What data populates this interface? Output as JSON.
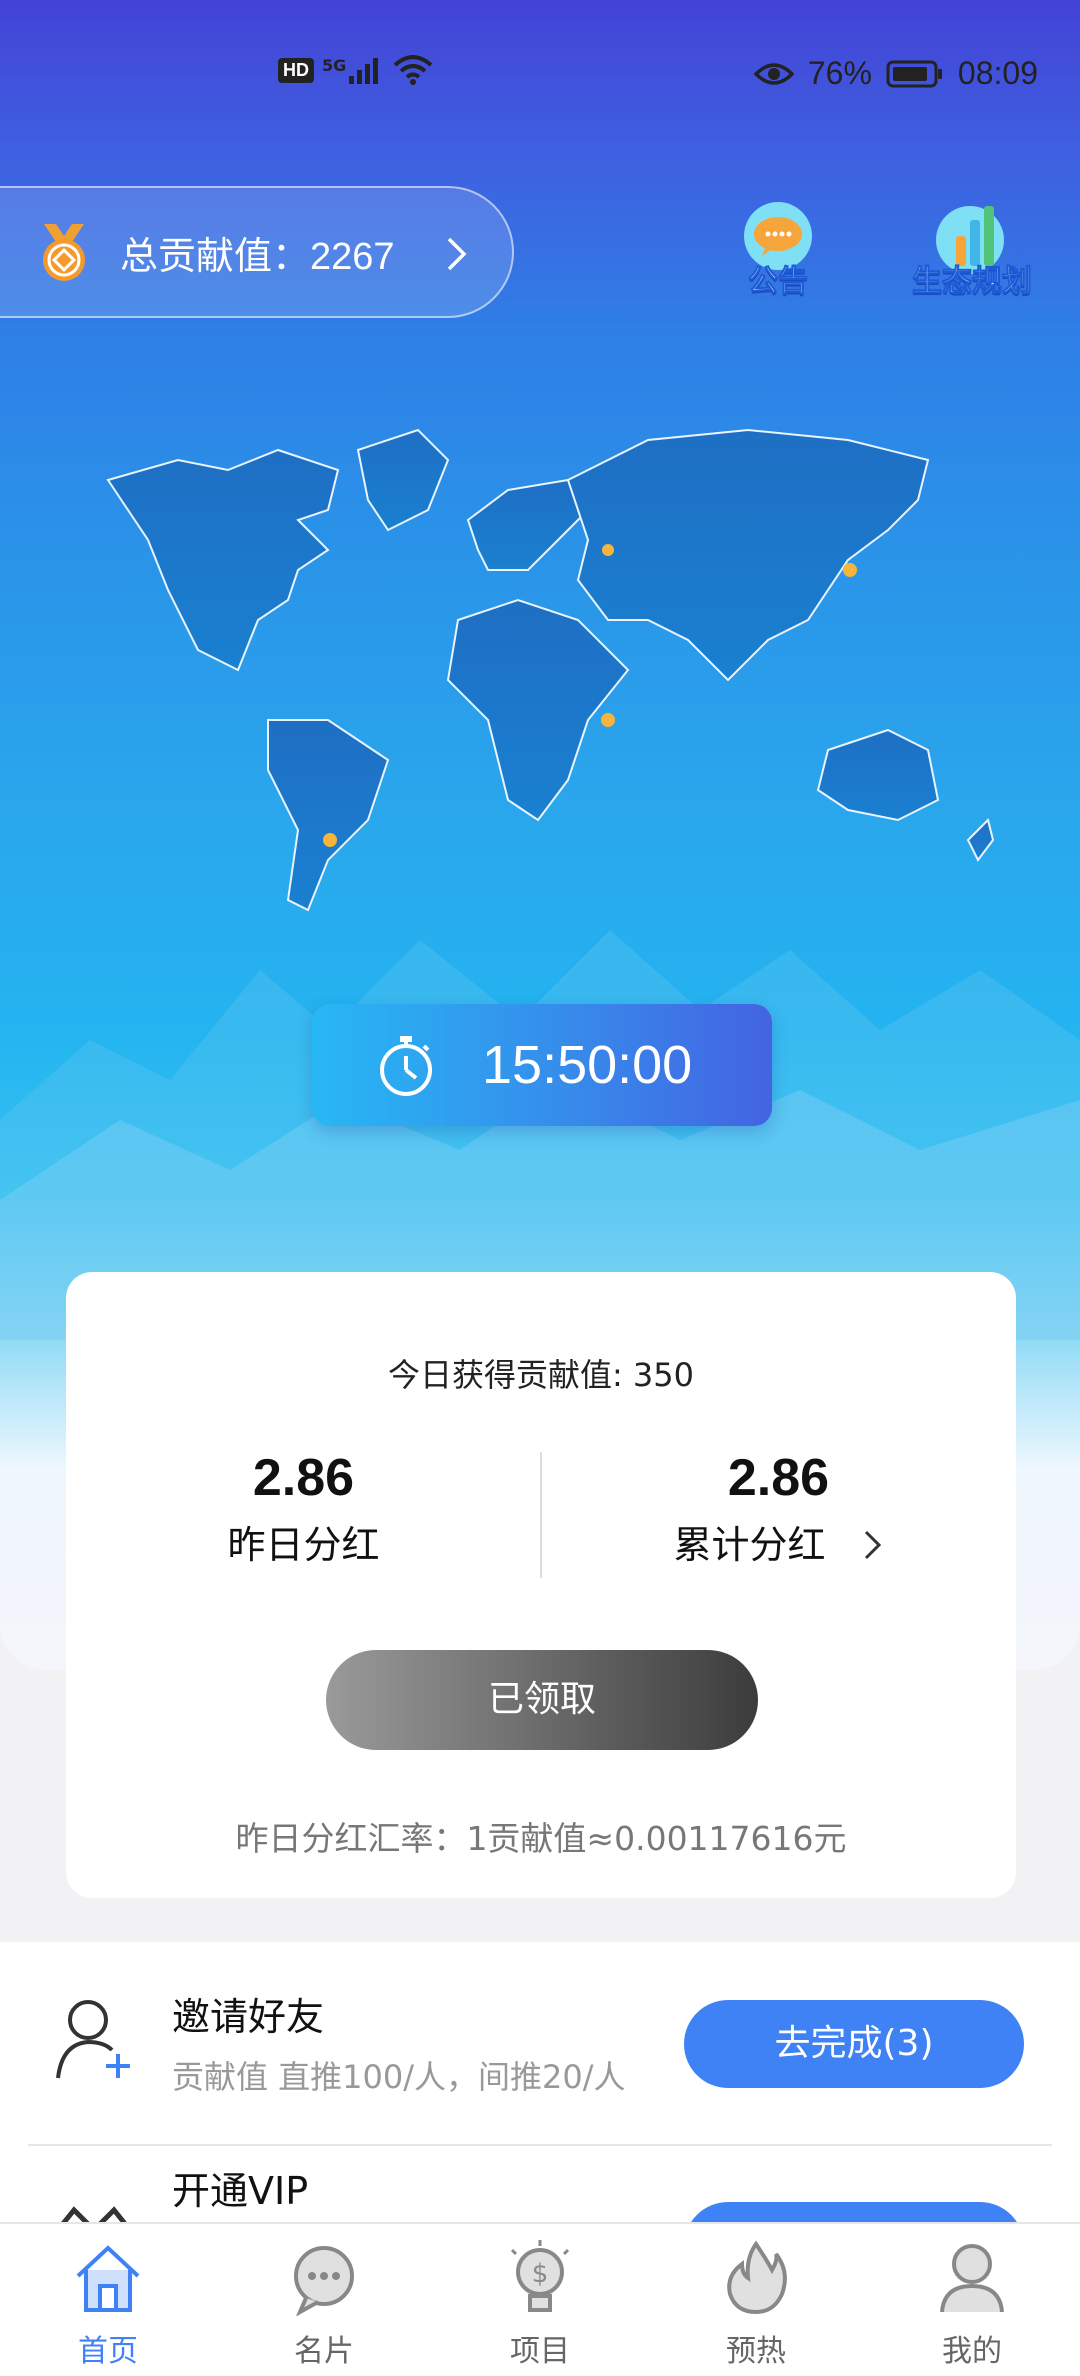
{
  "status_bar": {
    "network": "HD",
    "signal": "5G",
    "battery": "76%",
    "time": "08:09"
  },
  "header": {
    "contribution_label": "总贡献值：2267",
    "announcement_label": "公告",
    "ecology_label": "生态规划"
  },
  "timer": {
    "time": "15:50:00"
  },
  "card": {
    "today_label": "今日获得贡献值: 350",
    "yesterday_value": "2.86",
    "yesterday_label": "昨日分红",
    "total_value": "2.86",
    "total_label": "累计分红",
    "claim_button": "已领取",
    "rate_text": "昨日分红汇率：1贡献值≈0.00117616元"
  },
  "tasks": [
    {
      "title": "邀请好友",
      "subtitle": "贡献值 直推100/人，间推20/人",
      "button": "去完成(3)",
      "icon": "add-user-icon"
    },
    {
      "title": "开通VIP",
      "subtitle": "",
      "button": "",
      "icon": "crown-icon"
    }
  ],
  "nav": [
    {
      "label": "首页",
      "icon": "home-icon",
      "active": true
    },
    {
      "label": "名片",
      "icon": "chat-bubble-icon",
      "active": false
    },
    {
      "label": "项目",
      "icon": "lightbulb-dollar-icon",
      "active": false
    },
    {
      "label": "预热",
      "icon": "flame-icon",
      "active": false
    },
    {
      "label": "我的",
      "icon": "user-icon",
      "active": false
    }
  ],
  "colors": {
    "accent": "#3f82f6",
    "hero_top": "#4343d6",
    "hero_bottom": "#24b4f0"
  }
}
